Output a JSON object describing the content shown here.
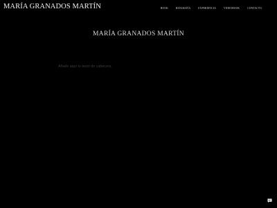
{
  "header": {
    "logo": "MARÍA GRANADOS MARTÍN",
    "nav": [
      {
        "label": "BOOK"
      },
      {
        "label": "BIOGRAFÍA"
      },
      {
        "label": "EXPERIENCIA"
      },
      {
        "label": "VIDEOBOOK"
      },
      {
        "label": "CONTACTO"
      }
    ]
  },
  "hero": {
    "title": "MARÍA GRANADOS MARTÍN",
    "header_text": "Añade aquí tu texto de cabecera"
  },
  "chat": {
    "icon": "chat-bubble-icon"
  },
  "colors": {
    "background": "#000000",
    "text": "#f2f2f2",
    "muted": "#3c3c3c"
  }
}
